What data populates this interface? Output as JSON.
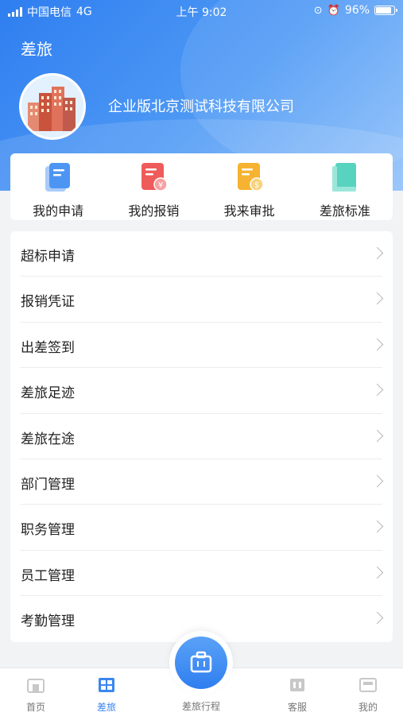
{
  "status_bar": {
    "carrier": "中国电信",
    "network": "4G",
    "time": "上午 9:02",
    "battery_percent": "96%",
    "battery_level": 0.96
  },
  "header": {
    "title": "差旅",
    "company": "企业版北京测试科技有限公司"
  },
  "quick_actions": [
    {
      "label": "我的申请",
      "icon": "document-icon",
      "color": "#4d95f3"
    },
    {
      "label": "我的报销",
      "icon": "reimbursement-icon",
      "color": "#ef5b5b"
    },
    {
      "label": "我来审批",
      "icon": "approval-icon",
      "color": "#f5b331"
    },
    {
      "label": "差旅标准",
      "icon": "book-icon",
      "color": "#57d3c0"
    }
  ],
  "menu": [
    {
      "label": "超标申请"
    },
    {
      "label": "报销凭证"
    },
    {
      "label": "出差签到"
    },
    {
      "label": "差旅足迹"
    },
    {
      "label": "差旅在途"
    },
    {
      "label": "部门管理"
    },
    {
      "label": "职务管理"
    },
    {
      "label": "员工管理"
    },
    {
      "label": "考勤管理"
    }
  ],
  "tabbar": {
    "home": "首页",
    "travel": "差旅",
    "trip": "差旅行程",
    "service": "客服",
    "mine": "我的",
    "active": "差旅"
  },
  "colors": {
    "brand": "#3a86f0",
    "header_gradient_start": "#2f7ef0",
    "header_gradient_end": "#8ec0fb"
  }
}
